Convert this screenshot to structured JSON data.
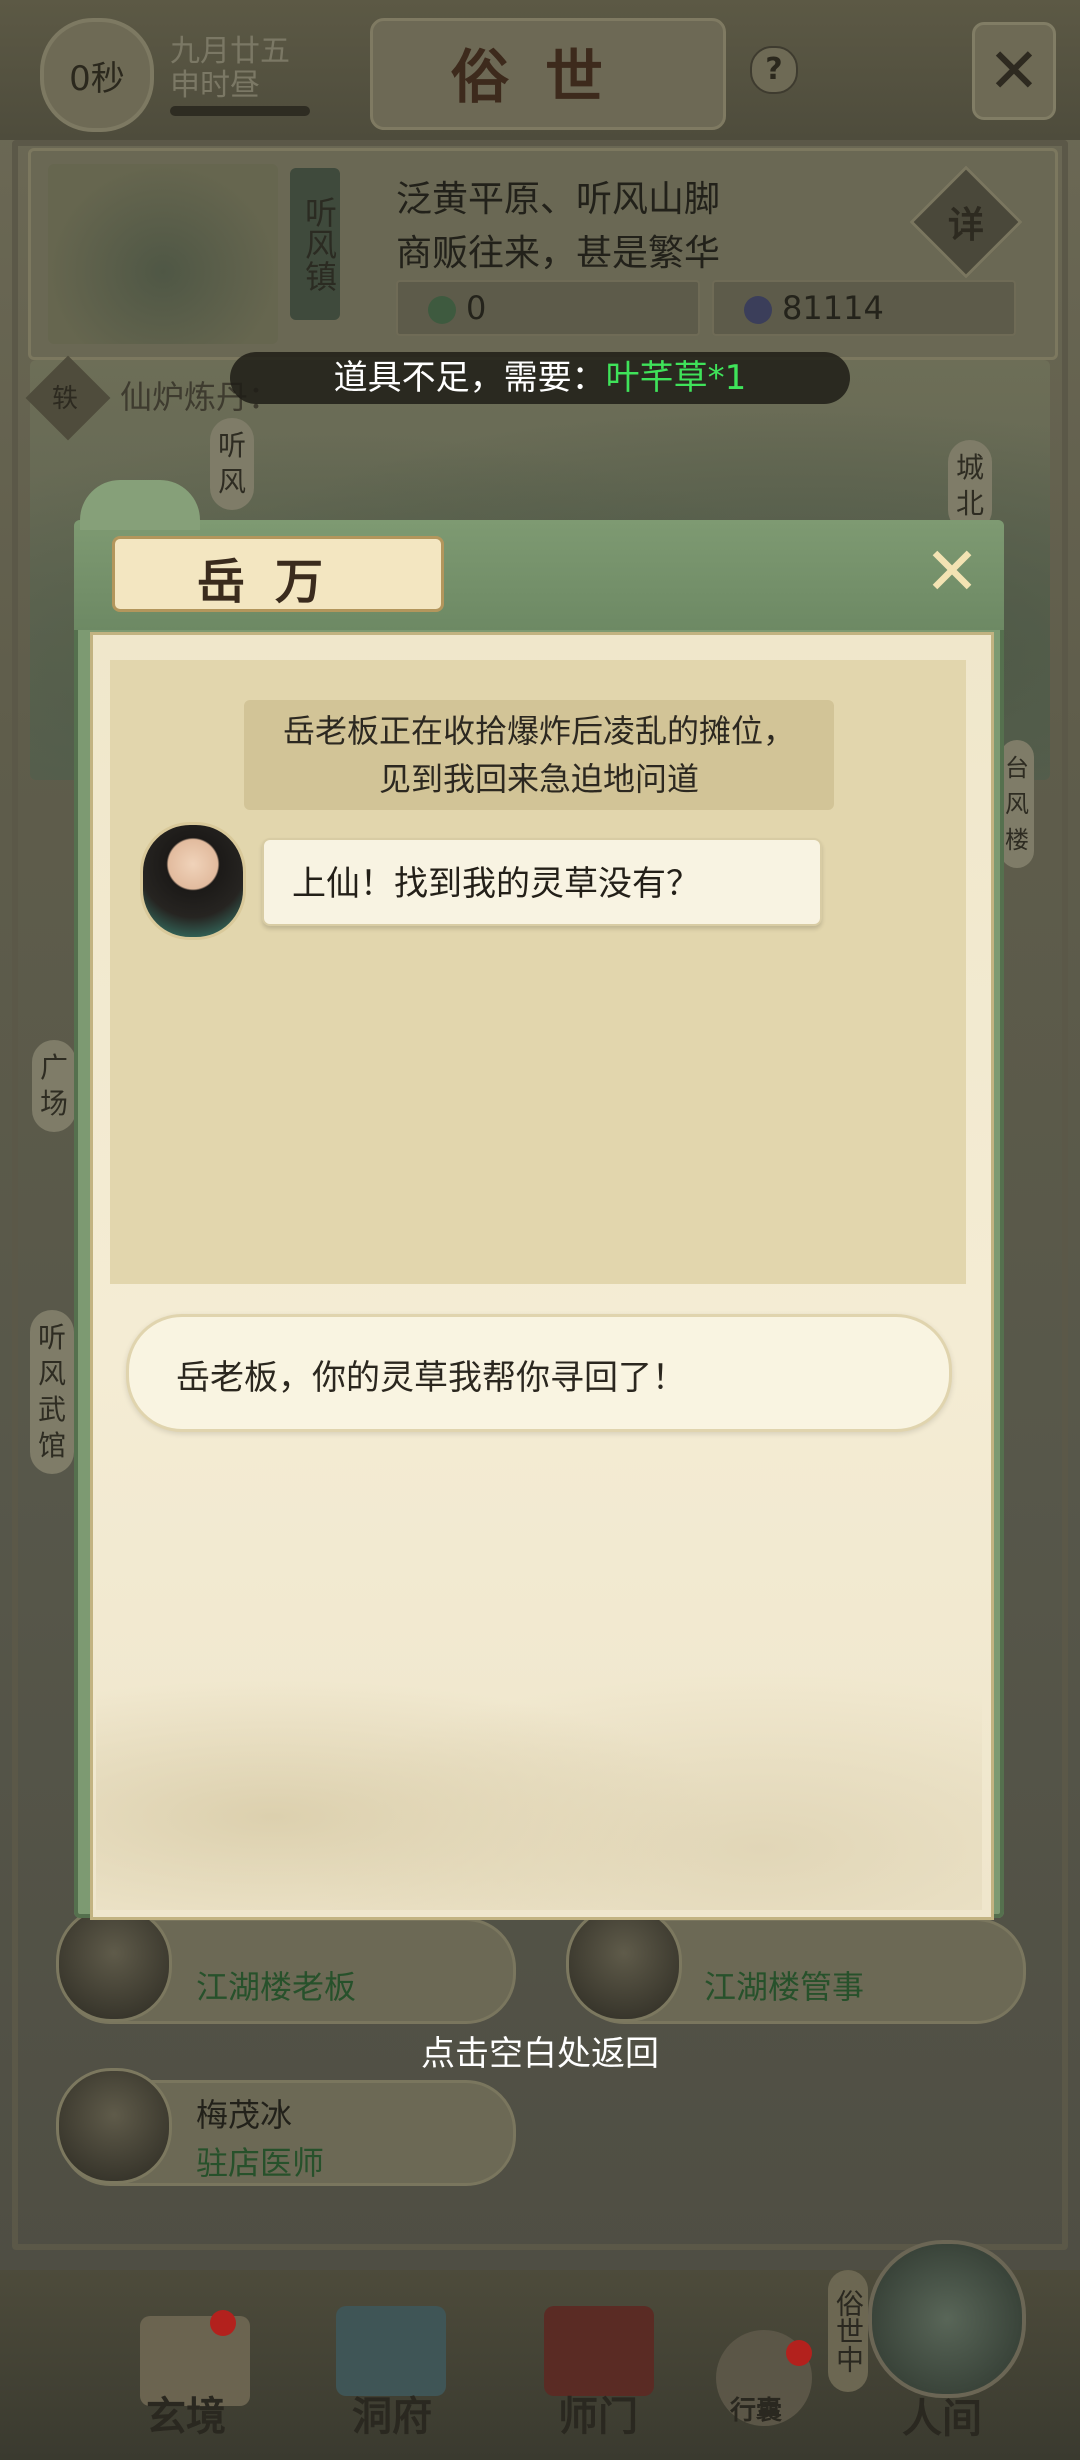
{
  "top_bar": {
    "timer": "0秒",
    "date_line1": "九月廿五",
    "date_line2": "申时昼",
    "title": "俗世",
    "help_label": "?",
    "close_label": "✕"
  },
  "location": {
    "town_name": "听风镇",
    "line1": "泛黄平原、听风山脚",
    "line2": "商贩往来，甚是繁华",
    "detail_label": "详",
    "resources": [
      {
        "value": "0",
        "color": "#3e8a4b",
        "icon": "jade-icon"
      },
      {
        "value": "81114",
        "color": "#5a5f9a",
        "icon": "coin-icon"
      }
    ]
  },
  "toast": {
    "prefix": "道具不足，需要：",
    "item": "叶芊草*1"
  },
  "background": {
    "craft_label": "仙炉炼丹：",
    "craft_badge": "轶",
    "signs": {
      "tingfeng_top": "听风",
      "chengbei": "城北",
      "guangchang": "广场",
      "wuguan": "听风武馆",
      "feng_lou": "台风楼"
    }
  },
  "npc_list": [
    {
      "name": "",
      "role": "江湖楼老板"
    },
    {
      "name": "",
      "role": "江湖楼管事"
    },
    {
      "name": "梅茂冰",
      "role": "驻店医师"
    }
  ],
  "return_hint": "点击空白处返回",
  "dialog": {
    "title": "岳万",
    "close_label": "✕",
    "narration_line1": "岳老板正在收拾爆炸后凌乱的摊位，",
    "narration_line2": "见到我回来急迫地问道",
    "speech": "上仙！找到我的灵草没有？",
    "choice": "岳老板，你的灵草我帮你寻回了！"
  },
  "bottom_nav": {
    "items": [
      {
        "label": "玄境",
        "badge": true
      },
      {
        "label": "洞府",
        "badge": false
      },
      {
        "label": "师门",
        "badge": false
      },
      {
        "label": "行囊",
        "badge": true
      },
      {
        "label": "人间",
        "badge": false
      }
    ],
    "status_tag": "俗世中"
  }
}
